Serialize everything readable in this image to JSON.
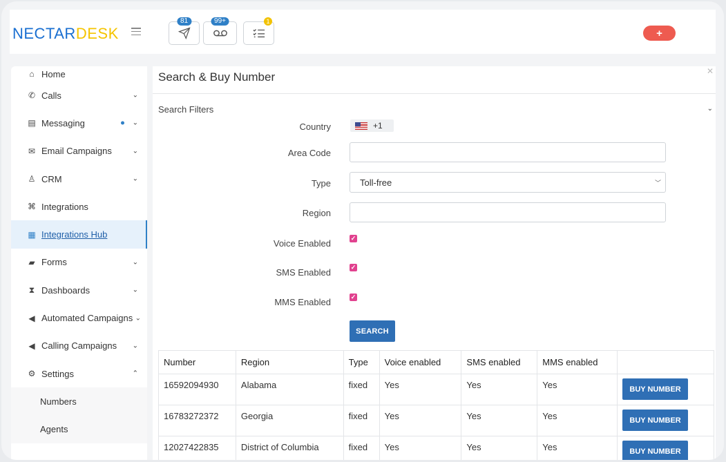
{
  "header": {
    "logo_part1": "NECTAR",
    "logo_part2": "DESK",
    "icons": [
      {
        "name": "send-icon",
        "badge": "81"
      },
      {
        "name": "voicemail-icon",
        "badge": "99+"
      },
      {
        "name": "tasks-icon",
        "badge": "1"
      }
    ],
    "plus_label": "+"
  },
  "sidebar": {
    "items": [
      {
        "label": "Home",
        "icon": "home-icon"
      },
      {
        "label": "Calls",
        "icon": "phone-icon"
      },
      {
        "label": "Messaging",
        "icon": "message-icon"
      },
      {
        "label": "Email Campaigns",
        "icon": "mail-icon"
      },
      {
        "label": "CRM",
        "icon": "user-icon"
      },
      {
        "label": "Integrations",
        "icon": "tag-icon"
      },
      {
        "label": "Integrations Hub",
        "icon": "grid-icon"
      },
      {
        "label": "Forms",
        "icon": "folder-icon"
      },
      {
        "label": "Dashboards",
        "icon": "hourglass-icon"
      },
      {
        "label": "Automated Campaigns",
        "icon": "megaphone-icon"
      },
      {
        "label": "Calling Campaigns",
        "icon": "megaphone-icon"
      },
      {
        "label": "Settings",
        "icon": "gear-icon"
      }
    ],
    "sub_items": [
      "Numbers",
      "Agents"
    ]
  },
  "main": {
    "title": "Search & Buy Number",
    "filters_title": "Search Filters",
    "form": {
      "country_label": "Country",
      "country_code": "+1",
      "area_code_label": "Area Code",
      "area_code_value": "",
      "type_label": "Type",
      "type_value": "Toll-free",
      "region_label": "Region",
      "region_value": "",
      "voice_label": "Voice Enabled",
      "sms_label": "SMS Enabled",
      "mms_label": "MMS Enabled",
      "search_label": "SEARCH"
    },
    "table": {
      "headers": [
        "Number",
        "Region",
        "Type",
        "Voice enabled",
        "SMS enabled",
        "MMS enabled",
        ""
      ],
      "rows": [
        {
          "number": "16592094930",
          "region": "Alabama",
          "type": "fixed",
          "voice": "Yes",
          "sms": "Yes",
          "mms": "Yes",
          "action": "BUY NUMBER"
        },
        {
          "number": "16783272372",
          "region": "Georgia",
          "type": "fixed",
          "voice": "Yes",
          "sms": "Yes",
          "mms": "Yes",
          "action": "BUY NUMBER"
        },
        {
          "number": "12027422835",
          "region": "District of Columbia",
          "type": "fixed",
          "voice": "Yes",
          "sms": "Yes",
          "mms": "Yes",
          "action": "BUY NUMBER"
        }
      ]
    }
  },
  "colors": {
    "brand_blue": "#1a6fd1",
    "brand_yellow": "#f5c400",
    "primary_button": "#2f6fb5",
    "accent_red": "#ee5b50",
    "checkbox_pink": "#e1428f"
  }
}
